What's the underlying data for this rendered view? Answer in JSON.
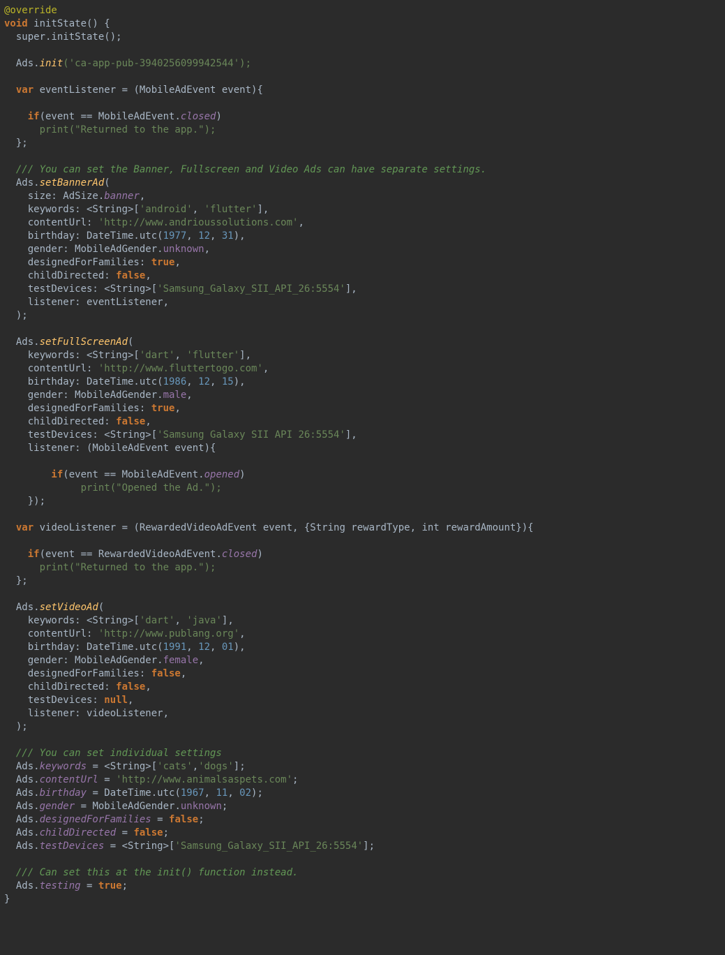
{
  "colors": {
    "background": "#2b2b2b",
    "default": "#a9b7c6",
    "annotation": "#bbb529",
    "keyword": "#cc7832",
    "function": "#ffc66d",
    "string": "#6a8759",
    "number": "#6897bb",
    "member": "#9876aa",
    "comment": "#629755"
  },
  "t": {
    "override": "@override",
    "void": "void",
    "initStateSig": " initState() {",
    "superInit": "  super.initState();",
    "adsInitPrefix": "  Ads.",
    "init": "init",
    "adsInitArgs": "('ca-app-pub-3940256099942544');",
    "var": "  var",
    "eventListenerDecl": " eventListener = (MobileAdEvent event){",
    "ifOpen": "    if",
    "ifClosedCond": "(event == MobileAdEvent.",
    "closed": "closed",
    "rparen": ")",
    "printReturned": "      print(\"Returned to the app.\");",
    "closeBraceSemi": "  };",
    "commentBanner": "  /// You can set the Banner, Fullscreen and Video Ads can have separate settings.",
    "setBannerAd": "setBannerAd",
    "openParen": "(",
    "sizeLabel": "    size: AdSize.",
    "banner": "banner",
    "comma": ",",
    "keywords1a": "    keywords: <String>[",
    "android": "'android'",
    "sep": ", ",
    "flutter": "'flutter'",
    "closeBracketComma": "],",
    "contentUrlLabel": "    contentUrl: ",
    "url1": "'http://www.andrioussolutions.com'",
    "birthdayLabel": "    birthday: DateTime.utc(",
    "y1977": "1977",
    "m12": "12",
    "d31": "31",
    "closeParenComma": "),",
    "genderLabel": "    gender: MobileAdGender.",
    "unknown": "unknown",
    "dffLabel": "    designedForFamilies: ",
    "true": "true",
    "commaOnly": ",",
    "cdLabel": "    childDirected: ",
    "false": "false",
    "testDevicesLabel": "    testDevices: <String>[",
    "device1": "'Samsung_Galaxy_SII_API_26:5554'",
    "listener1": "    listener: eventListener,",
    "closeCall": "  );",
    "setFullScreenAd": "setFullScreenAd",
    "dart": "'dart'",
    "url2": "'http://www.fluttertogo.com'",
    "y1986": "1986",
    "d15": "15",
    "male": "male",
    "device2": "'Samsung Galaxy SII API 26:5554'",
    "listenerInline": "    listener: (MobileAdEvent event){",
    "ifOpenedIndent": "        if",
    "opened": "opened",
    "printOpened": "             print(\"Opened the Ad.\");",
    "closeInline": "    });",
    "videoListenerDecl": " videoListener = (RewardedVideoAdEvent event, {String rewardType, int rewardAmount}){",
    "ifRewardedClosedCond": "(event == RewardedVideoAdEvent.",
    "setVideoAd": "setVideoAd",
    "java": "'java'",
    "url3": "'http://www.publang.org'",
    "y1991": "1991",
    "d01": "01",
    "female": "female",
    "testDevicesNullLabel": "    testDevices: ",
    "null": "null",
    "listener3": "    listener: videoListener,",
    "commentIndiv": "  /// You can set individual settings",
    "adsKeywords": "keywords",
    "eqStrOpen": " = <String>[",
    "cats": "'cats'",
    "commaNoSpace": ",",
    "dogs": "'dogs'",
    "closeBracketSemi": "];",
    "adsContentUrl": "contentUrl",
    "eq": " = ",
    "url4": "'http://www.animalsaspets.com'",
    "semi": ";",
    "adsBirthday": "birthday",
    "eqDateTime": " = DateTime.utc(",
    "y1967": "1967",
    "m11": "11",
    "d02": "02",
    "closeParenSemi": ");",
    "adsGender": "gender",
    "eqMobileAdGender": " = MobileAdGender.",
    "adsDff": "designedForFamilies",
    "adsCd": "childDirected",
    "adsTestDevices": "testDevices",
    "commentInit": "  /// Can set this at the init() function instead.",
    "adsTesting": "testing",
    "closeFn": "}",
    "adsDot": "  Ads."
  }
}
